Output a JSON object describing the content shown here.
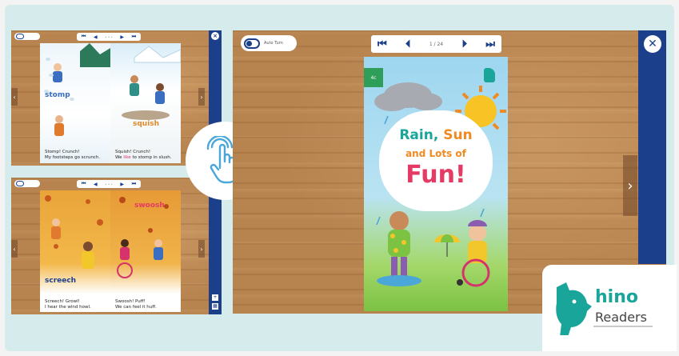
{
  "colors": {
    "background": "#d6ecec",
    "wood": "#b7834f",
    "sidebar_blue": "#1b3f8b",
    "teal": "#1aa59a",
    "orange": "#f08a24",
    "pink": "#e53a63"
  },
  "main_reader": {
    "toggle_label": "Auto Turn",
    "page_counter": "1 / 24",
    "cover": {
      "level_badge": "4c",
      "title_line1_a": "Rain,",
      "title_line1_b": "Sun",
      "title_line2": "and Lots of",
      "title_line3": "Fun!"
    },
    "icons": {
      "first": "first-page-icon",
      "prev": "prev-page-icon",
      "next": "next-page-icon",
      "last": "last-page-icon",
      "close": "close-icon",
      "next_arrow": "chevron-right-icon"
    }
  },
  "thumb_top": {
    "left_page": {
      "sfx": "stomp",
      "caption_line1": "Stomp! Crunch!",
      "caption_line2": "My footsteps go scrunch."
    },
    "right_page": {
      "sfx": "squish",
      "caption_line1": "Squish! Crunch!",
      "caption_line2_a": "We",
      "caption_line2_hl": "like",
      "caption_line2_b": "to stomp in slush."
    }
  },
  "thumb_bottom": {
    "left_page": {
      "sfx": "screech",
      "caption_line1": "Screech! Growl!",
      "caption_line2": "I hear the wind howl."
    },
    "right_page": {
      "sfx": "swoosh",
      "caption_line1": "Swoosh! Puff!",
      "caption_line2": "We can feel it huff."
    }
  },
  "tap_icon": "tap-hand-icon",
  "logo": {
    "mark": "rhino-icon",
    "name": "hino",
    "sub": "Readers"
  }
}
